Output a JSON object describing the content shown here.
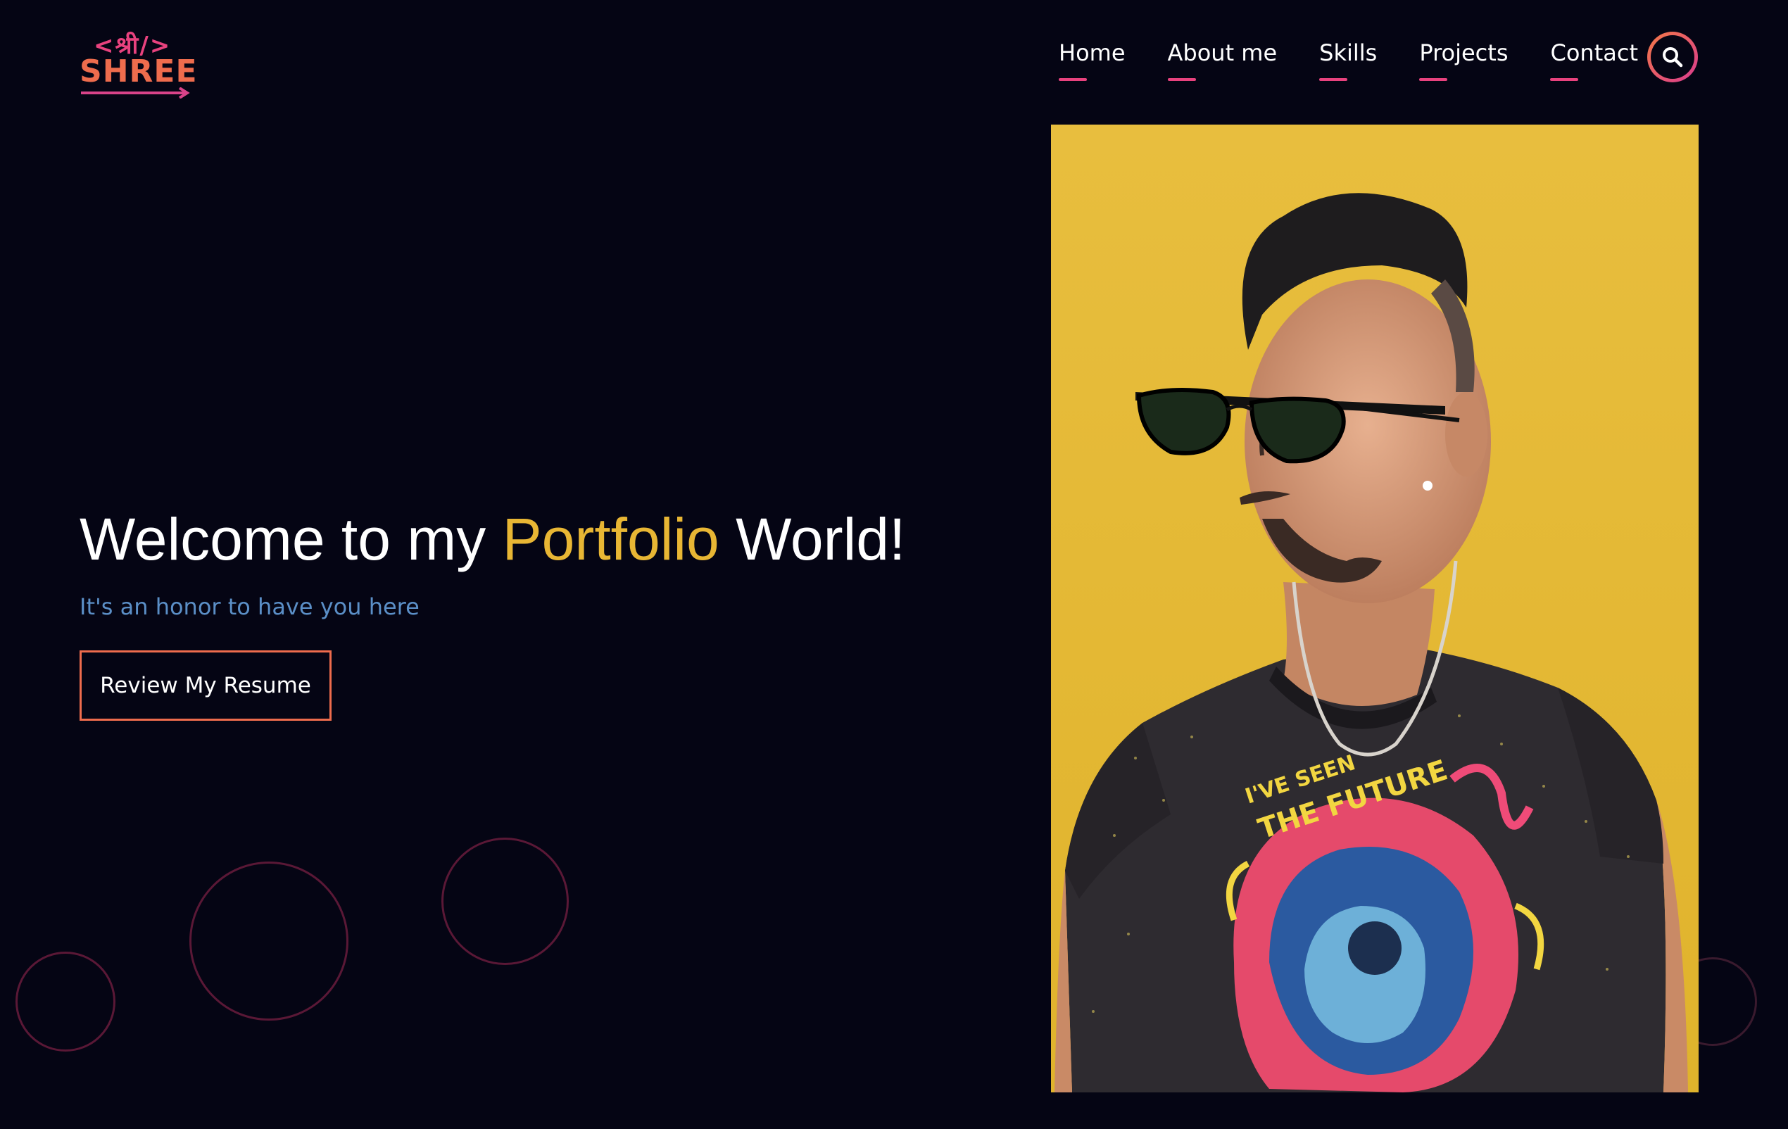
{
  "logo": {
    "top_text": "<श्री/>",
    "word": "SHREE"
  },
  "nav": {
    "items": [
      {
        "label": "Home"
      },
      {
        "label": "About me"
      },
      {
        "label": "Skills"
      },
      {
        "label": "Projects"
      },
      {
        "label": "Contact"
      }
    ],
    "search_icon": "search-icon"
  },
  "hero": {
    "title_prefix": "Welcome to my",
    "title_accent": "Portfolio",
    "title_suffix": "World!",
    "subtitle": "It's an honor to have you here",
    "button_label": "Review My Resume"
  },
  "photo": {
    "shirt_text_line1": "I'VE SEEN",
    "shirt_text_line2": "THE FUTURE"
  },
  "colors": {
    "background": "#050514",
    "accent_pink": "#e8427e",
    "accent_orange": "#ee6c4d",
    "accent_yellow": "#e8b634",
    "subtitle_blue": "#5b8fc7",
    "photo_bg": "#e5b93a"
  }
}
